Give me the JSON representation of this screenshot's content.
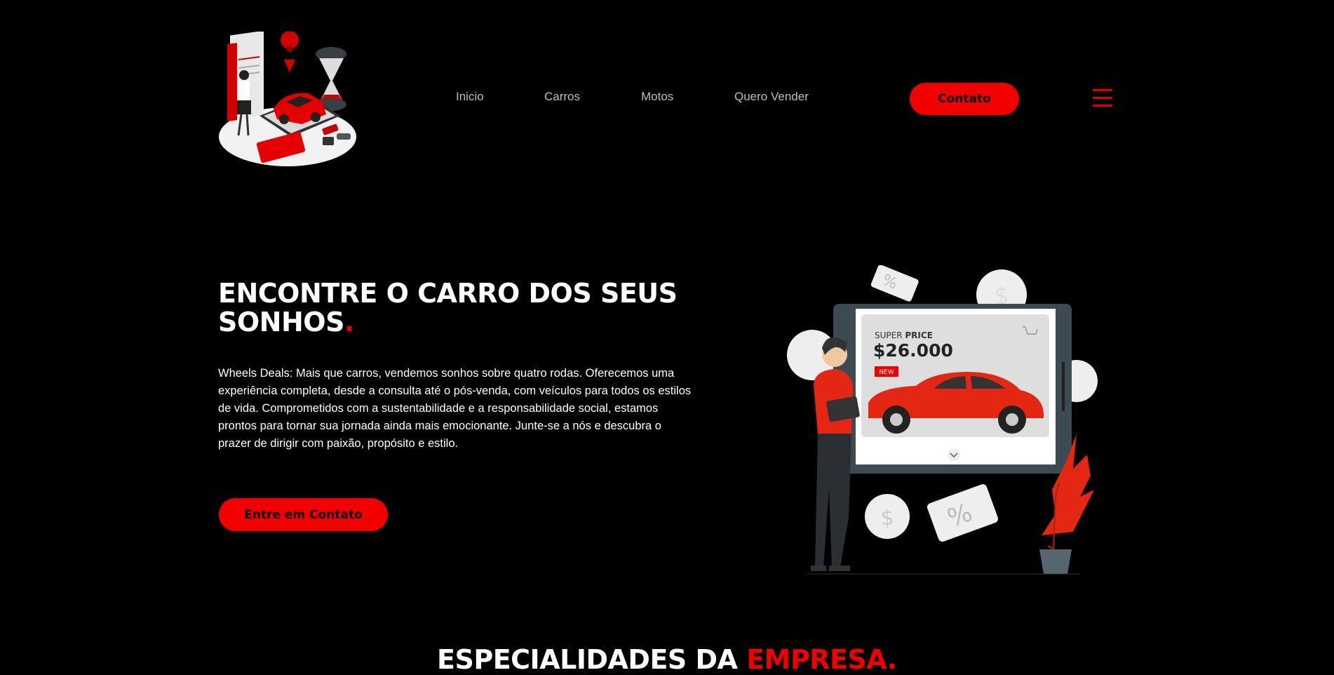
{
  "nav": {
    "items": [
      {
        "label": "Inicio"
      },
      {
        "label": "Carros"
      },
      {
        "label": "Motos"
      },
      {
        "label": "Quero Vender"
      }
    ],
    "contact_label": "Contato"
  },
  "hero": {
    "title_main": "ENCONTRE O CARRO DOS SEUS SONHOS",
    "title_dot": ".",
    "description": "Wheels Deals: Mais que carros, vendemos sonhos sobre quatro rodas. Oferecemos uma experiência completa, desde a consulta até o pós-venda, com veículos para todos os estilos de vida. Comprometidos com a sustentabilidade e a responsabilidade social, estamos prontos para tornar sua jornada ainda mais emocionante. Junte-se a nós e descubra o prazer de dirigir com paixão, propósito e estilo.",
    "cta_label": "Entre em Contato"
  },
  "illustration": {
    "super": "SUPER",
    "price_word": "PRICE",
    "price": "$26.000",
    "badge": "NEW"
  },
  "section": {
    "title_main": "ESPECIALIDADES DA ",
    "title_accent": "EMPRESA."
  },
  "colors": {
    "accent": "#f20000",
    "background": "#000000"
  }
}
